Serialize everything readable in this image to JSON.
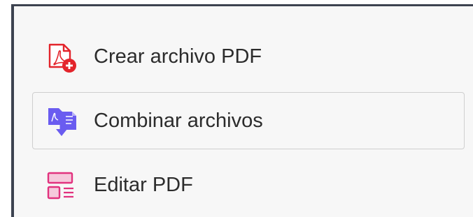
{
  "tools": {
    "items": [
      {
        "label": "Crear archivo PDF",
        "icon": "create-pdf-icon",
        "selected": false,
        "accent": "#e3242b"
      },
      {
        "label": "Combinar archivos",
        "icon": "combine-files-icon",
        "selected": true,
        "accent": "#6a5cf0"
      },
      {
        "label": "Editar PDF",
        "icon": "edit-pdf-icon",
        "selected": false,
        "accent": "#e1327e"
      }
    ]
  },
  "colors": {
    "panel_background": "#f7f7f7",
    "frame": "#3d4350",
    "selected_border": "#cfcfcf",
    "text": "#2c2c2c"
  }
}
